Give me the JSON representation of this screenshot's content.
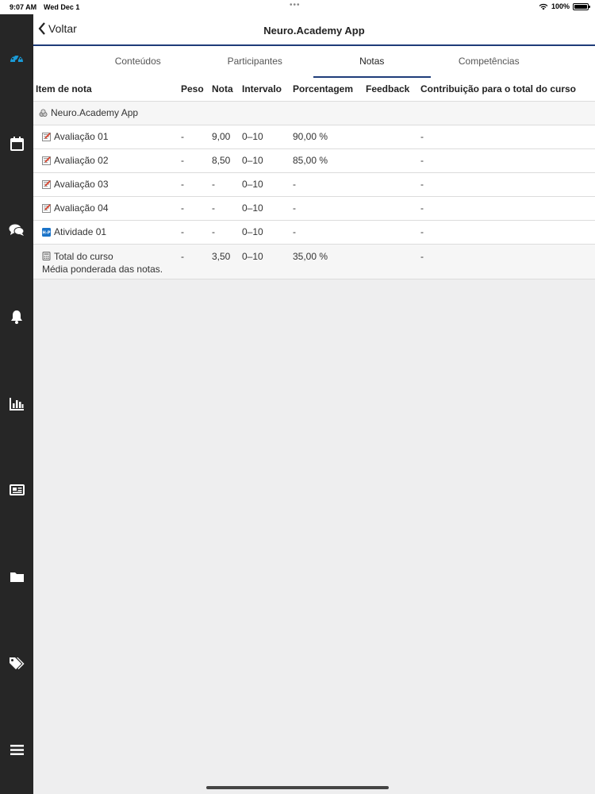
{
  "status_bar": {
    "time": "9:07 AM",
    "date": "Wed Dec 1",
    "battery": "100%"
  },
  "sidebar": {
    "items": [
      {
        "icon": "dashboard-icon"
      },
      {
        "icon": "calendar-icon"
      },
      {
        "icon": "messages-icon"
      },
      {
        "icon": "bell-icon"
      },
      {
        "icon": "bar-chart-icon"
      },
      {
        "icon": "news-icon"
      },
      {
        "icon": "folder-icon"
      },
      {
        "icon": "tags-icon"
      },
      {
        "icon": "menu-icon"
      }
    ],
    "active_color": "#1a9bd7"
  },
  "header": {
    "back_label": "Voltar",
    "title": "Neuro.Academy App"
  },
  "tabs": [
    {
      "label": "Conteúdos"
    },
    {
      "label": "Participantes"
    },
    {
      "label": "Notas",
      "active": true
    },
    {
      "label": "Competências"
    }
  ],
  "table": {
    "columns": [
      "Item de nota",
      "Peso",
      "Nota",
      "Intervalo",
      "Porcentagem",
      "Feedback",
      "Contribuição para o total do curso"
    ],
    "category": {
      "name": "Neuro.Academy App",
      "icon": "category-icon"
    },
    "rows": [
      {
        "icon": "assignment-icon",
        "name": "Avaliação 01",
        "peso": "-",
        "nota": "9,00",
        "intervalo": "0–10",
        "porcentagem": "90,00 %",
        "feedback": "",
        "contribuicao": "-"
      },
      {
        "icon": "assignment-icon",
        "name": "Avaliação 02",
        "peso": "-",
        "nota": "8,50",
        "intervalo": "0–10",
        "porcentagem": "85,00 %",
        "feedback": "",
        "contribuicao": "-"
      },
      {
        "icon": "assignment-icon",
        "name": "Avaliação 03",
        "peso": "-",
        "nota": "-",
        "intervalo": "0–10",
        "porcentagem": "-",
        "feedback": "",
        "contribuicao": "-"
      },
      {
        "icon": "assignment-icon",
        "name": "Avaliação 04",
        "peso": "-",
        "nota": "-",
        "intervalo": "0–10",
        "porcentagem": "-",
        "feedback": "",
        "contribuicao": "-"
      },
      {
        "icon": "h5p-icon",
        "name": "Atividade 01",
        "peso": "-",
        "nota": "-",
        "intervalo": "0–10",
        "porcentagem": "-",
        "feedback": "",
        "contribuicao": "-"
      }
    ],
    "total": {
      "icon": "calculator-icon",
      "name": "Total do curso",
      "subtitle": "Média ponderada das notas.",
      "peso": "-",
      "nota": "3,50",
      "intervalo": "0–10",
      "porcentagem": "35,00 %",
      "feedback": "",
      "contribuicao": "-"
    }
  }
}
